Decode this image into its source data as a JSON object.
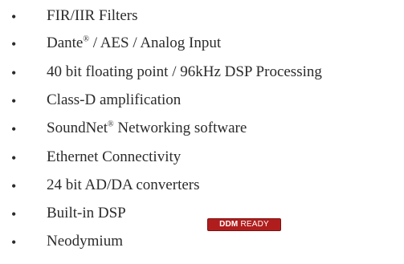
{
  "features": [
    {
      "prefix": "FIR/IIR Filters",
      "sup": "",
      "suffix": ""
    },
    {
      "prefix": "Dante",
      "sup": "®",
      "suffix": " / AES / Analog Input"
    },
    {
      "prefix": "40 bit floating point / 96kHz DSP Processing",
      "sup": "",
      "suffix": ""
    },
    {
      "prefix": "Class-D amplification",
      "sup": "",
      "suffix": ""
    },
    {
      "prefix": "SoundNet",
      "sup": "®",
      "suffix": " Networking software"
    },
    {
      "prefix": "Ethernet Connectivity",
      "sup": "",
      "suffix": ""
    },
    {
      "prefix": "24 bit AD/DA converters",
      "sup": "",
      "suffix": ""
    },
    {
      "prefix": "Built-in DSP",
      "sup": "",
      "suffix": ""
    },
    {
      "prefix": "Neodymium",
      "sup": "",
      "suffix": ""
    }
  ],
  "bullet_glyph": "•",
  "badge": {
    "strong": "DDM",
    "light": "READY",
    "color": "#b01d1d"
  }
}
